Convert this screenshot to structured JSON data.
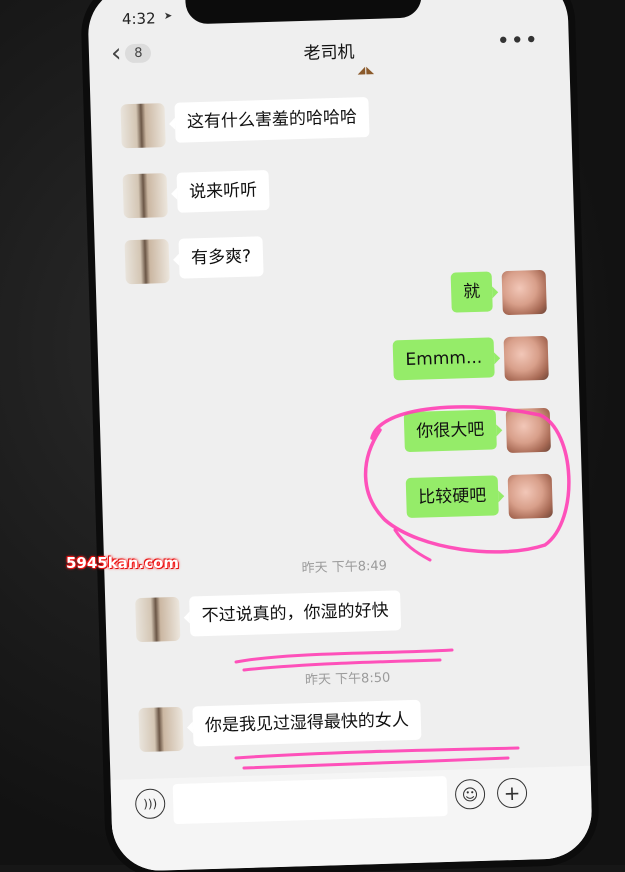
{
  "status_bar": {
    "time": "4:32",
    "location_icon": "location-arrow-icon"
  },
  "header": {
    "back_icon": "chevron-left-icon",
    "unread_count": "8",
    "title": "老司机",
    "more_icon": "ellipsis-icon"
  },
  "messages": [
    {
      "side": "left",
      "text": "这有什么害羞的哈哈哈"
    },
    {
      "side": "left",
      "text": "说来听听"
    },
    {
      "side": "left",
      "text": "有多爽?"
    },
    {
      "side": "right",
      "text": "就"
    },
    {
      "side": "right",
      "text": "Emmm..."
    },
    {
      "side": "right",
      "text": "你很大吧"
    },
    {
      "side": "right",
      "text": "比较硬吧"
    },
    {
      "side": "left",
      "text": "不过说真的，你湿的好快"
    },
    {
      "side": "left",
      "text": "你是我见过湿得最快的女人"
    }
  ],
  "timestamps": [
    "昨天 下午8:49",
    "昨天 下午8:50"
  ],
  "input_bar": {
    "voice_icon": "voice-icon",
    "input_value": "",
    "emoji_icon": "emoji-icon",
    "plus_icon": "plus-icon"
  },
  "watermark": "5945kan.com",
  "colors": {
    "sent_bubble": "#95ec69",
    "received_bubble": "#ffffff",
    "chat_background": "#efefef",
    "annotation_pink": "#ff3fb4"
  }
}
